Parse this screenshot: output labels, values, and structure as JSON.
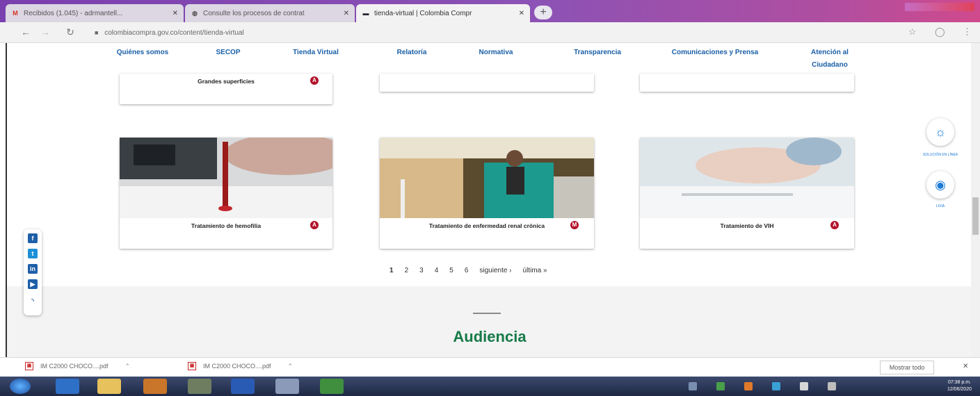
{
  "browser": {
    "tabs": [
      {
        "title": "Recibidos (1.045) - adrmantell...",
        "favicon": "gmail-icon"
      },
      {
        "title": "Consulte los procesos de contrat",
        "favicon": "globe-icon"
      },
      {
        "title": "tienda-virtual | Colombia Compr",
        "favicon": "cce-icon"
      }
    ],
    "url": "colombiacompra.gov.co/content/tienda-virtual"
  },
  "nav": {
    "items": [
      {
        "label": "Quiénes somos"
      },
      {
        "label": "SECOP"
      },
      {
        "label": "Tienda Virtual"
      },
      {
        "label": "Relatoría"
      },
      {
        "label": "Normativa"
      },
      {
        "label": "Transparencia"
      },
      {
        "label": "Comunicaciones y Prensa"
      },
      {
        "label": "Atención al Ciudadano"
      }
    ]
  },
  "top_cards": [
    {
      "caption": "Grandes superficies",
      "badge": "A"
    },
    {
      "caption": "",
      "badge": ""
    },
    {
      "caption": "",
      "badge": ""
    }
  ],
  "cards": [
    {
      "caption": "Tratamiento de hemofilia",
      "badge": "A"
    },
    {
      "caption": "Tratamiento de enfermedad renal crónica",
      "badge": "M"
    },
    {
      "caption": "Tratamiento de VIH",
      "badge": "A"
    }
  ],
  "pager": {
    "pages": [
      "1",
      "2",
      "3",
      "4",
      "5",
      "6"
    ],
    "next": "siguiente ›",
    "last": "última »"
  },
  "section_title": "Audiencia",
  "right_widgets": [
    {
      "label": "SOLUCIÓN EN LÍNEA",
      "icon": "lightbulb-icon"
    },
    {
      "label": "LIVIA",
      "icon": "chat-icon"
    }
  ],
  "downloads": [
    {
      "name": "IM C2000 CHOCO....pdf"
    },
    {
      "name": "IM C2000 CHOCO....pdf"
    }
  ],
  "download_bar": {
    "show_all": "Mostrar todo"
  },
  "taskbar": {
    "time": "07:38 p.m.",
    "date": "12/06/2020"
  },
  "colors": {
    "nav_blue": "#1a5fa8",
    "accent_green": "#167a48",
    "badge_red": "#b3122b"
  }
}
